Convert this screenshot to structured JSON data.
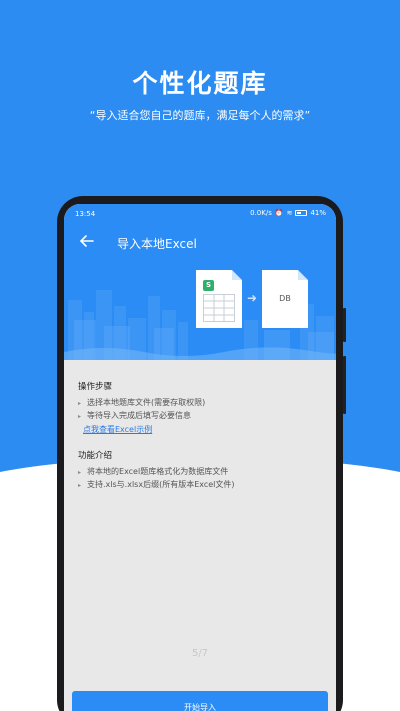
{
  "hero": {
    "title": "个性化题库",
    "subtitle": "“导入适合您自己的题库，满足每个人的需求”"
  },
  "status_bar": {
    "time": "13:54",
    "speed": "0.0K/s",
    "battery": "41%"
  },
  "app": {
    "title": "导入本地Excel",
    "illustration": {
      "xls_badge": "S",
      "db_label": "DB"
    }
  },
  "steps_section": {
    "title": "操作步骤",
    "items": [
      "选择本地题库文件(需要存取权限)",
      "等待导入完成后填写必要信息"
    ],
    "link": "点我查看Excel示例"
  },
  "features_section": {
    "title": "功能介绍",
    "items": [
      "将本地的Excel题库格式化为数据库文件",
      "支持.xls与.xlsx后缀(所有版本Excel文件)"
    ]
  },
  "page_indicator": "5/7",
  "start_button": "开始导入",
  "colors": {
    "primary": "#2a8cf4",
    "hero_bg": "#2d8cf2",
    "link": "#2a7be4"
  }
}
